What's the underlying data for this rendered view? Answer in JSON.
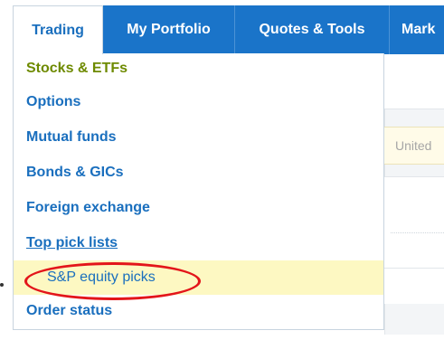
{
  "nav": {
    "tabs": [
      {
        "label": "Trading",
        "active": true
      },
      {
        "label": "My Portfolio"
      },
      {
        "label": "Quotes & Tools"
      },
      {
        "label": "Mark"
      }
    ]
  },
  "dropdown": {
    "items": [
      {
        "label": "Stocks & ETFs"
      },
      {
        "label": "Options"
      },
      {
        "label": "Mutual funds"
      },
      {
        "label": "Bonds & GICs"
      },
      {
        "label": "Foreign exchange"
      },
      {
        "label": "Top pick lists"
      },
      {
        "label": "S&P equity picks",
        "sub": true,
        "highlighted": true
      },
      {
        "label": "Order status"
      }
    ]
  },
  "background": {
    "field_text": "United"
  },
  "colors": {
    "nav_blue": "#1a74c9",
    "link_blue": "#1a6fbe",
    "active_green": "#6e8a00",
    "highlight_yellow": "#fdf8c2",
    "annotation_red": "#e3151a"
  }
}
